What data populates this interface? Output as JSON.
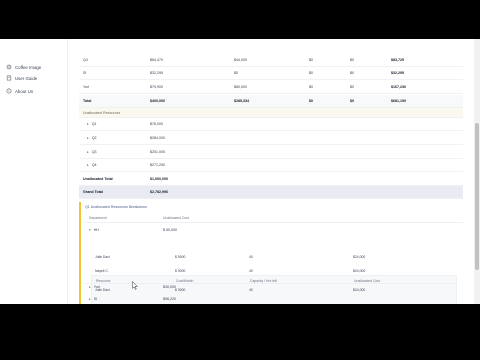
{
  "sidebar": {
    "items": [
      {
        "label": "Coffee Image",
        "icon": "gear-icon"
      },
      {
        "label": "User Guide",
        "icon": "book-icon"
      },
      {
        "label": "About Us",
        "icon": "info-icon"
      }
    ]
  },
  "main_rows": [
    {
      "name": "Q4",
      "c1": "$64,470",
      "c2": "$44,000",
      "c3": "$0",
      "c4": "$0",
      "c5": "$83,725"
    },
    {
      "name": "SI",
      "c1": "$32,295",
      "c2": "$0",
      "c3": "$0",
      "c4": "$0",
      "c5": "$32,295"
    },
    {
      "name": "Yuri",
      "c1": "$79,900",
      "c2": "$80,000",
      "c3": "$0",
      "c4": "$0",
      "c5": "$167,230"
    },
    {
      "name": "Total",
      "c1": "$400,000",
      "c2": "$285,334",
      "c3": "$0",
      "c4": "$0",
      "c5": "$681,190"
    }
  ],
  "unallocated": {
    "heading": "Unallocated Resources",
    "rows": [
      {
        "name": "Q1",
        "value": "$76,000"
      },
      {
        "name": "Q2",
        "value": "$284,000"
      },
      {
        "name": "Q3",
        "value": "$251,000"
      },
      {
        "name": "Q4",
        "value": "$271,250"
      }
    ],
    "total_label": "Unallocated Total",
    "total_value": "$1,060,000"
  },
  "grand_total": {
    "label": "Grand Total",
    "value": "$2,782,996"
  },
  "breakdown": {
    "title": "Q1 Unallocated Resources Breakdown",
    "headers": {
      "department": "Department",
      "unallocated_cost": "Unallocated Cost"
    },
    "rows": [
      {
        "name": "HH",
        "value": "$ 50,000",
        "expanded": true
      },
      {
        "name": "Yuri",
        "value": "$30,000",
        "expanded": false
      },
      {
        "name": "SI",
        "value": "$96,220",
        "expanded": false
      }
    ],
    "inner_headers": {
      "resource": "Resource",
      "cost_month": "Cost/Month",
      "capacity": "Capacity / Hrs left",
      "unallocated_cost": "Unallocated Cost"
    },
    "inner_rows": [
      {
        "resource": "Julie Davi",
        "cost": "$ 9000",
        "capacity": "40",
        "unallocated": "$24,000"
      },
      {
        "resource": "Nayeli C.",
        "cost": "$ 9000",
        "capacity": "40",
        "unallocated": "$24,000"
      }
    ]
  }
}
